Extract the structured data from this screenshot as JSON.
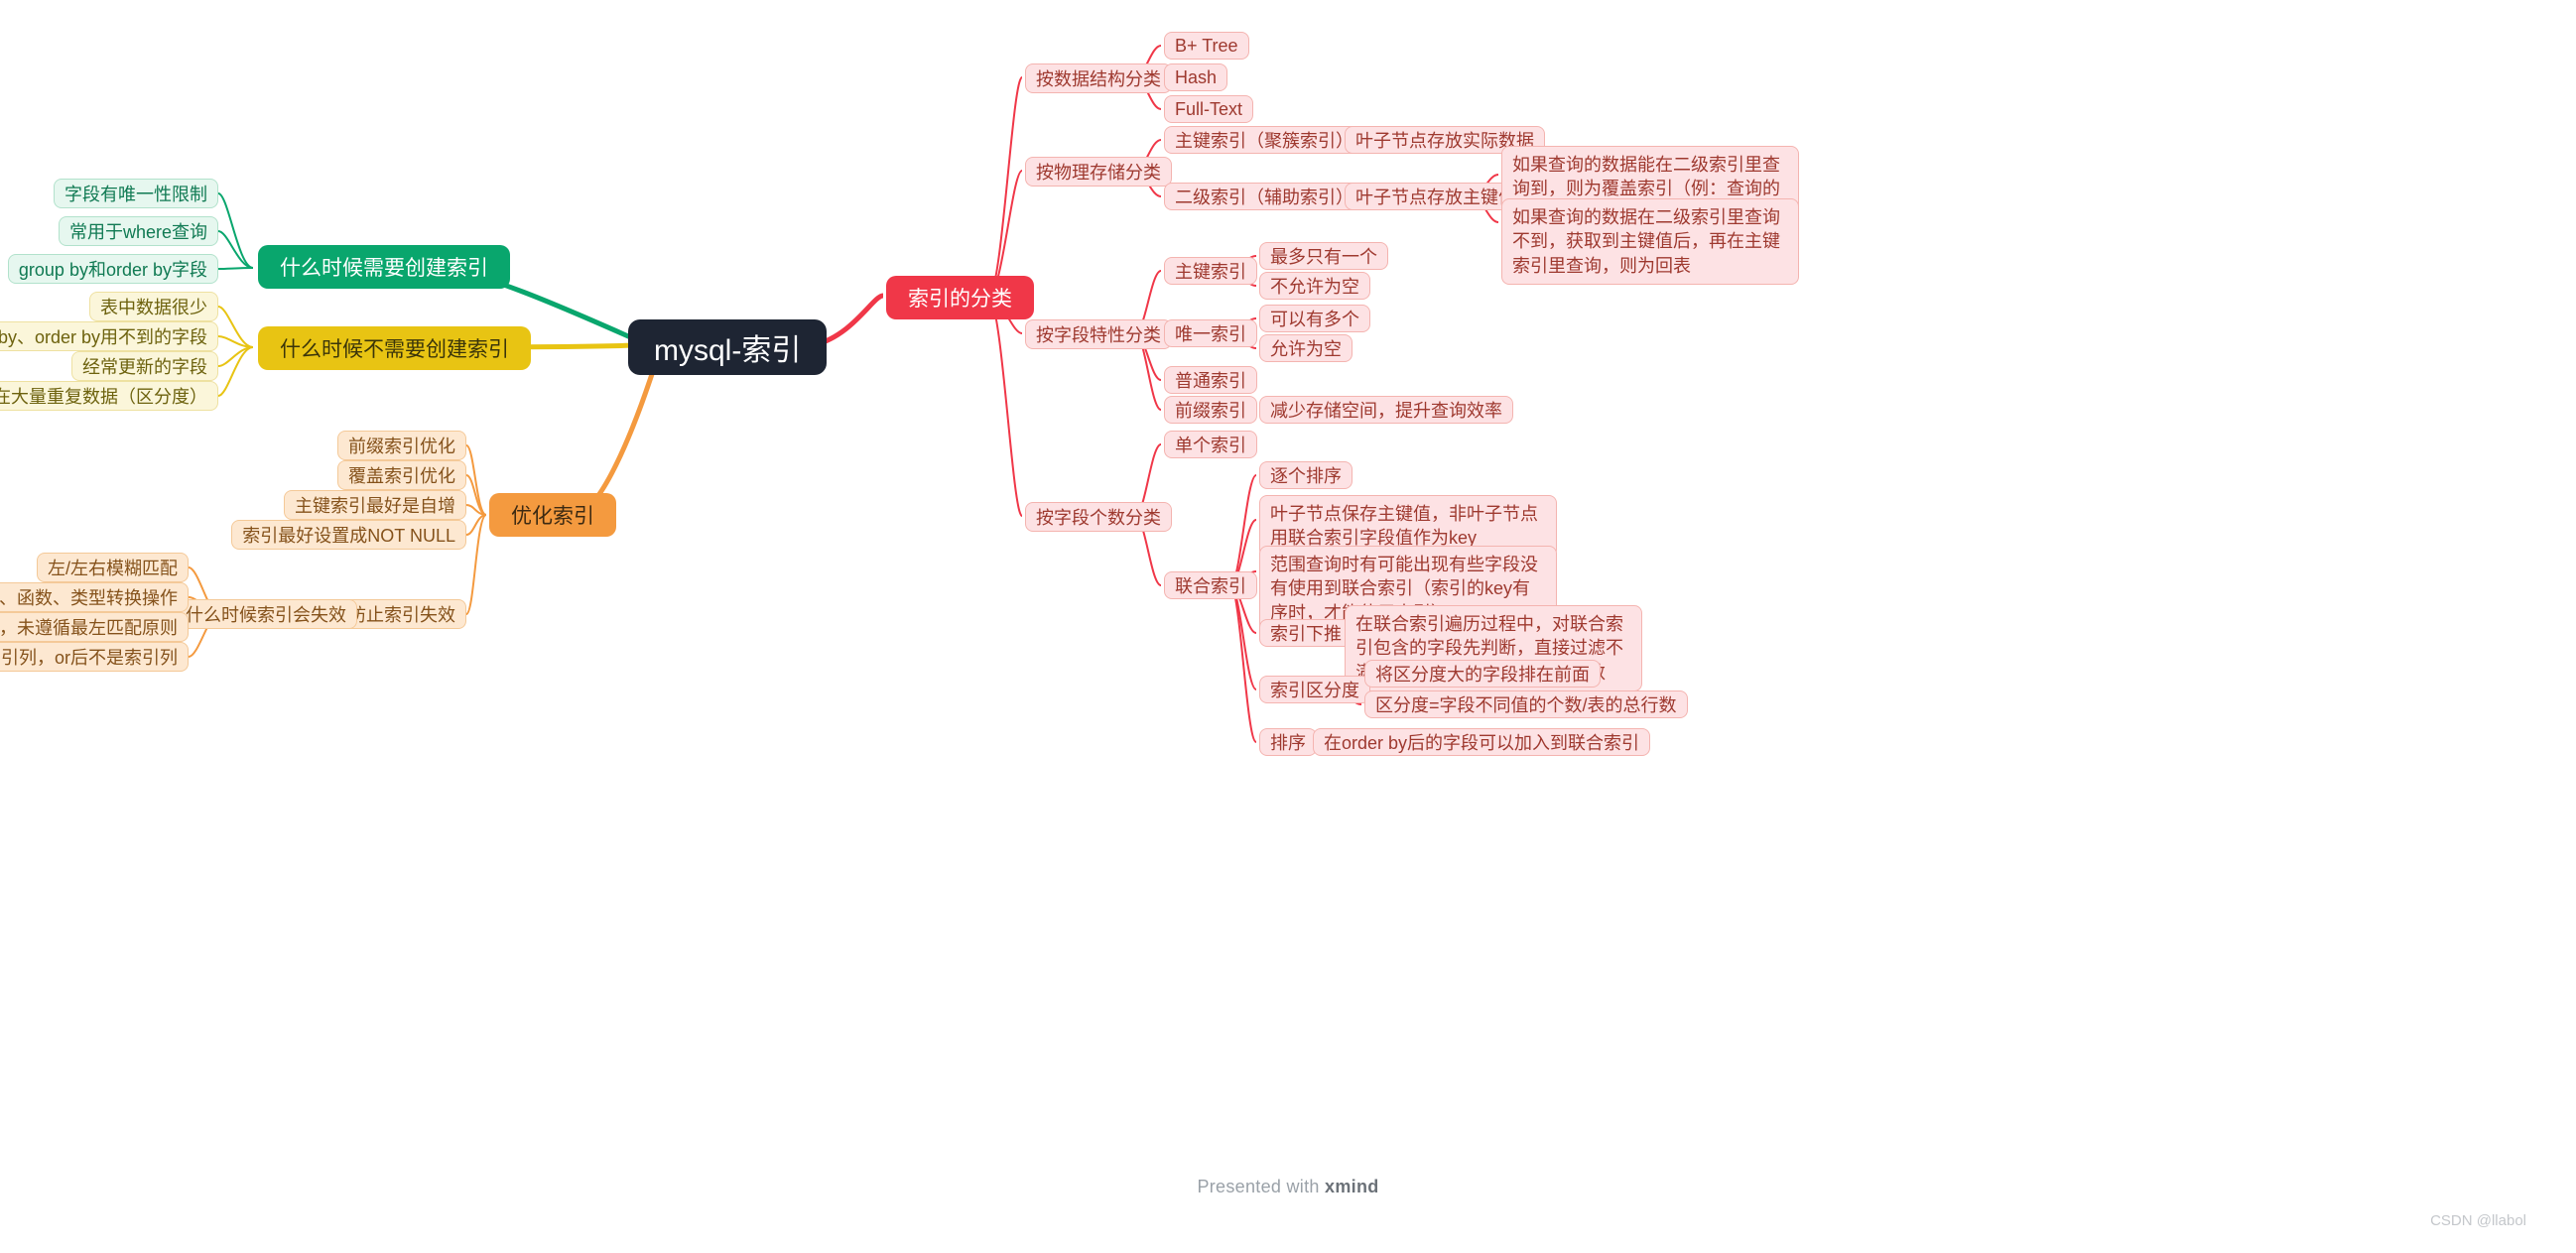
{
  "root": "mysql-索引",
  "green": {
    "title": "什么时候需要创建索引",
    "items": [
      "字段有唯一性限制",
      "常用于where查询",
      "group by和order by字段"
    ]
  },
  "yellow": {
    "title": "什么时候不需要创建索引",
    "items": [
      "表中数据很少",
      "where、group by、order by用不到的字段",
      "经常更新的字段",
      "字段存在大量重复数据（区分度）"
    ]
  },
  "orange": {
    "title": "优化索引",
    "items": [
      "前缀索引优化",
      "覆盖索引优化",
      "主键索引最好是自增",
      "索引最好设置成NOT NULL"
    ],
    "prevent": "防止索引失效",
    "when_fail": "什么时候索引会失效",
    "fails": [
      "左/左右模糊匹配",
      "对索引列做了计算、函数、类型转换操作",
      "联合索引不正确使用，未遵循最左匹配原则",
      "where子句中，or前是索引列，or后不是索引列"
    ]
  },
  "red": {
    "title": "索引的分类",
    "ds": {
      "title": "按数据结构分类",
      "items": [
        "B+ Tree",
        "Hash",
        "Full-Text"
      ]
    },
    "phys": {
      "title": "按物理存储分类",
      "pk": {
        "title": "主键索引（聚簇索引）",
        "note": "叶子节点存放实际数据"
      },
      "sec": {
        "title": "二级索引（辅助索引）",
        "note": "叶子节点存放主键值",
        "notes2": [
          "如果查询的数据能在二级索引里查询到，则为覆盖索引（例：查询的就是主键值）",
          "如果查询的数据在二级索引里查询不到，获取到主键值后，再在主键索引里查询，则为回表"
        ]
      }
    },
    "attr": {
      "title": "按字段特性分类",
      "pk": {
        "title": "主键索引",
        "items": [
          "最多只有一个",
          "不允许为空"
        ]
      },
      "uni": {
        "title": "唯一索引",
        "items": [
          "可以有多个",
          "允许为空"
        ]
      },
      "normal": "普通索引",
      "prefix": {
        "title": "前缀索引",
        "note": "减少存储空间，提升查询效率"
      }
    },
    "count": {
      "title": "按字段个数分类",
      "single": "单个索引",
      "comp": {
        "title": "联合索引",
        "items": [
          "逐个排序",
          "叶子节点保存主键值，非叶子节点用联合索引字段值作为key",
          "范围查询时有可能出现有些字段没有使用到联合索引（索引的key有序时，才能使用索引）"
        ],
        "pushdown": {
          "title": "索引下推",
          "note": "在联合索引遍历过程中，对联合索引包含的字段先判断，直接过滤不满足条件的记录，减少回表次数"
        },
        "disc": {
          "title": "索引区分度",
          "items": [
            "将区分度大的字段排在前面",
            "区分度=字段不同值的个数/表的总行数"
          ]
        },
        "sort": {
          "title": "排序",
          "note": "在order by后的字段可以加入到联合索引"
        }
      }
    }
  },
  "footer": {
    "prefix": "Presented with ",
    "brand": "xmind"
  },
  "watermark": "CSDN @llabol"
}
